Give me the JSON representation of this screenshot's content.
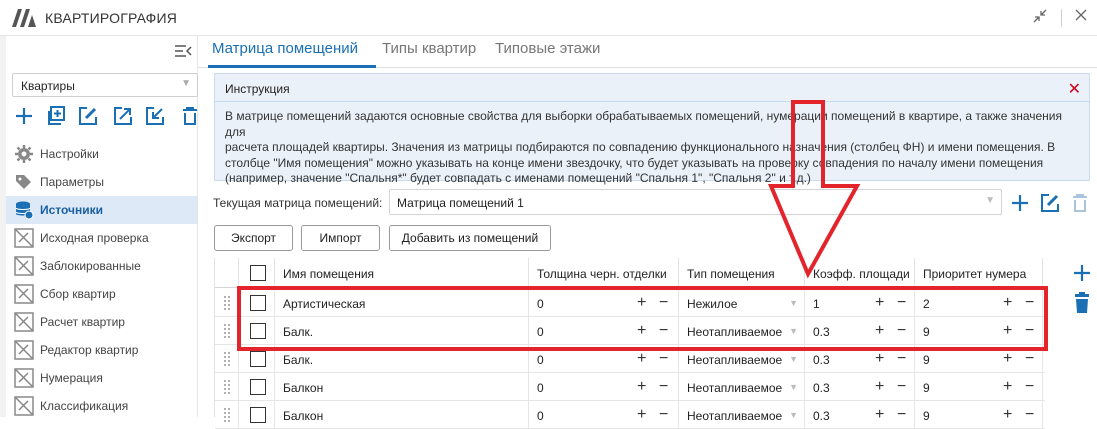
{
  "app": {
    "title": "КВАРТИРОГРАФИЯ"
  },
  "sidebar": {
    "combo_value": "Квартиры",
    "items": [
      {
        "label": "Настройки",
        "icon": "gear-icon",
        "active": false
      },
      {
        "label": "Параметры",
        "icon": "tags-icon",
        "active": false
      },
      {
        "label": "Источники",
        "icon": "database-icon",
        "active": true
      },
      {
        "label": "Исходная проверка",
        "icon": "plugin-icon",
        "active": false
      },
      {
        "label": "Заблокированные",
        "icon": "plugin-icon",
        "active": false
      },
      {
        "label": "Сбор квартир",
        "icon": "plugin-icon",
        "active": false
      },
      {
        "label": "Расчет квартир",
        "icon": "plugin-icon",
        "active": false
      },
      {
        "label": "Редактор квартир",
        "icon": "plugin-icon",
        "active": false
      },
      {
        "label": "Нумерация",
        "icon": "plugin-icon",
        "active": false
      },
      {
        "label": "Классификация",
        "icon": "plugin-icon",
        "active": false
      }
    ]
  },
  "tabs": [
    {
      "label": "Матрица помещений",
      "active": true
    },
    {
      "label": "Типы квартир",
      "active": false
    },
    {
      "label": "Типовые этажи",
      "active": false
    }
  ],
  "info": {
    "title": "Инструкция",
    "lines": [
      "В матрице помещений задаются основные свойства для выборки обрабатываемых помещений, нумерации помещений в квартире, а также значения для",
      "расчета площадей квартиры. Значения из матрицы подбираются по совпадению функционального назначения (столбец ФН) и имени помещения. В",
      "столбце \"Имя помещения\" можно указывать на конце имени звездочку, что будет указывать на проверку совпадения по началу имени помещения",
      "(например, значение \"Спальня*\" будет совпадать с именами помещений \"Спальня 1\", \"Спальня 2\" и т.д.)"
    ]
  },
  "current_matrix": {
    "label": "Текущая матрица помещений:",
    "value": "Матрица помещений 1"
  },
  "buttons": {
    "export": "Экспорт",
    "import": "Импорт",
    "add_from_rooms": "Добавить из помещений"
  },
  "table": {
    "headers": [
      "Имя помещения",
      "Толщина черн. отделки",
      "Тип помещения",
      "Коэфф. площади",
      "Приоритет нумера"
    ],
    "rows": [
      {
        "name": "Артистическая",
        "thickness": "0",
        "type": "Нежилое",
        "coef": "1",
        "priority": "2"
      },
      {
        "name": "Балк.",
        "thickness": "0",
        "type": "Неотапливаемое",
        "coef": "0.3",
        "priority": "9"
      },
      {
        "name": "Балк.",
        "thickness": "0",
        "type": "Неотапливаемое",
        "coef": "0.3",
        "priority": "9"
      },
      {
        "name": "Балкон",
        "thickness": "0",
        "type": "Неотапливаемое",
        "coef": "0.3",
        "priority": "9"
      },
      {
        "name": "Балкон",
        "thickness": "0",
        "type": "Неотапливаемое",
        "coef": "0.3",
        "priority": "9"
      }
    ]
  },
  "colors": {
    "accent": "#1a6fb5",
    "annotation": "#e3242b",
    "info_bg": "#eaf1f9",
    "active_nav_bg": "#dde9f6"
  }
}
